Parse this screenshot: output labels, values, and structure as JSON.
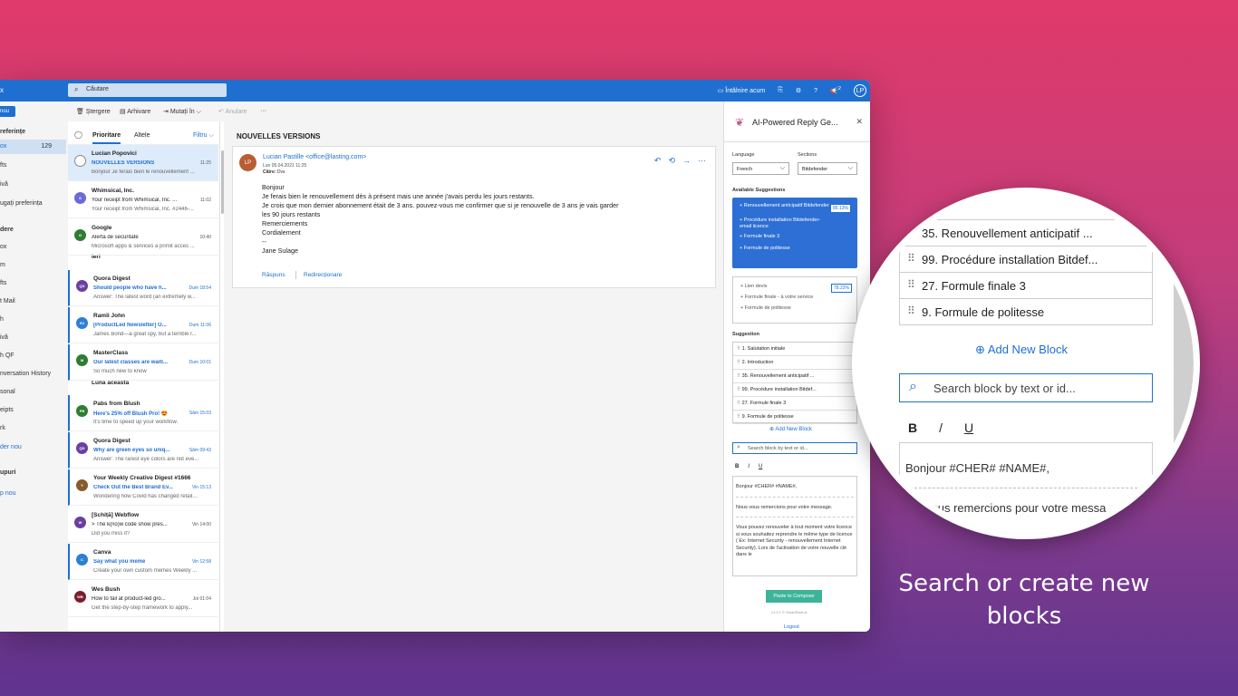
{
  "topbar": {
    "brand": "x",
    "search_placeholder": "Căutare",
    "meet_now": "Întâlnire acum",
    "help": "?",
    "avatar": "LP",
    "notif_count": "2"
  },
  "cmdbar": {
    "new": "nou",
    "delete": "Ștergere",
    "archive": "Arhivare",
    "move": "Mutați în",
    "undo": "Anulare",
    "more": "···"
  },
  "nav": {
    "fav_header": "referințe",
    "items": [
      {
        "label": "ox",
        "count": "129"
      },
      {
        "label": "fts",
        "count": "1"
      },
      {
        "label": "ivă",
        "count": ""
      },
      {
        "label": "ugați preferința",
        "count": ""
      }
    ],
    "folders_header": "dere",
    "folders": [
      {
        "label": "ox",
        "count": "129"
      },
      {
        "label": "m",
        "count": "3"
      },
      {
        "label": "fts",
        "count": "1"
      },
      {
        "label": "t Mail",
        "count": ""
      },
      {
        "label": "h",
        "count": ""
      },
      {
        "label": "ivă",
        "count": ""
      },
      {
        "label": "h QF",
        "count": ""
      },
      {
        "label": "nversation History",
        "count": ""
      },
      {
        "label": "sonal",
        "count": ""
      },
      {
        "label": "eipts",
        "count": ""
      },
      {
        "label": "rk",
        "count": ""
      }
    ],
    "new_folder": "der nou",
    "groups_header": "upuri",
    "new_group": "p nou"
  },
  "list": {
    "tab_focused": "Prioritare",
    "tab_other": "Altele",
    "filter": "Filtru",
    "group_yesterday": "Ieri",
    "group_month": "Luna aceasta",
    "messages": [
      {
        "from": "Lucian Popovici",
        "subject": "NOUVELLES VERSIONS",
        "time": "11:25",
        "preview": "Bonjour Je ferais bien le renouvellement ...",
        "initials": "",
        "color": "#ffffff"
      },
      {
        "from": "Whimsical, Inc.",
        "subject": "Your receipt from Whimsical, Inc. ...",
        "time": "11:02",
        "preview": "Your receipt from Whimsical, Inc. #2446-...",
        "initials": "S",
        "color": "#6a6ad8"
      },
      {
        "from": "Google",
        "subject": "Alertă de securitate",
        "time": "10:40",
        "preview": "Microsoft apps & services a primit acces ...",
        "initials": "G",
        "color": "#2e7d32"
      },
      {
        "from": "Quora Digest",
        "subject": "Should people who have h...",
        "time": "Dum 18:54",
        "preview": "Answer: The latest word (an extremely w...",
        "initials": "QD",
        "color": "#6b3fa0"
      },
      {
        "from": "Ramli John",
        "subject": "[ProductLed Newsletter] O...",
        "time": "Dum 11:06",
        "preview": "James Bond—a great spy, but a terrible r...",
        "initials": "RJ",
        "color": "#2d7fd4"
      },
      {
        "from": "MasterClass",
        "subject": "Our latest classes are waiti...",
        "time": "Dum 10:01",
        "preview": "So much new to know",
        "initials": "M",
        "color": "#2e7d32"
      },
      {
        "from": "Pabs from Blush",
        "subject": "Here's 25% off Blush Pro! 😍",
        "time": "Sâm 15:03",
        "preview": "It's time to speed up your workflow.",
        "initials": "PB",
        "color": "#2e7d32"
      },
      {
        "from": "Quora Digest",
        "subject": "Why are green eyes so uniq...",
        "time": "Sâm 09:43",
        "preview": "Answer: The rarest eye colors are not eve...",
        "initials": "QD",
        "color": "#6b3fa0"
      },
      {
        "from": "Your Weekly Creative Digest #1666",
        "subject": "Check Out the Best Brand Ev...",
        "time": "Vin 15:13",
        "preview": "Wondering how Covid has changed retail...",
        "initials": "Y",
        "color": "#8a5a2a"
      },
      {
        "from": "[Schiță] Webflow",
        "subject": "> The k(no)w code show pres...",
        "time": "Vin 14:00",
        "preview": "Did you miss it?",
        "initials": "W",
        "color": "#6b3fa0"
      },
      {
        "from": "Canva",
        "subject": "Say what you meme",
        "time": "Vin 12:58",
        "preview": "Create your own custom memes Weekly ...",
        "initials": "C",
        "color": "#2d7fd4"
      },
      {
        "from": "Wes Bush",
        "subject": "How to fail at product-led gro...",
        "time": "Joi 01:04",
        "preview": "Get the step-by-step framework to apply...",
        "initials": "WB",
        "color": "#7a1f2a"
      }
    ]
  },
  "reading": {
    "title": "NOUVELLES VERSIONS",
    "avatar": "LP",
    "sender": "Lucian Pastille <office@lasting.com>",
    "date": "Lun 05.04.2021 11:25",
    "to_label": "Către:",
    "to_value": "Dvs",
    "body": [
      "Bonjour",
      "Je ferais bien le renouvellement dès à présent mais une année j'avais perdu les jours restants.",
      "Je crois que mon dernier abonnement était de 3 ans. pouvez-vous me confirmer que si je renouvelle de 3 ans je vais garder",
      "les 90 jours restants",
      "Remerciements",
      "Cordialement",
      "--",
      "Jane Sulage"
    ],
    "reply": "Răspuns",
    "forward": "Redirecționare"
  },
  "pane": {
    "title": "AI-Powered Reply Ge...",
    "language_label": "Language",
    "language_value": "French",
    "sections_label": "Sections",
    "sections_value": "Bitdefender",
    "available_label": "Available Suggestions",
    "available": [
      {
        "text": "Renouvellement anticipatif Bitdefender",
        "pct": "85.13%"
      },
      {
        "text": "Procédure installation Bitdefender-email licence",
        "pct": ""
      },
      {
        "text": "Formule finale 3",
        "pct": ""
      },
      {
        "text": "Formule de politesse",
        "pct": ""
      }
    ],
    "available2": [
      {
        "text": "Lien devis",
        "pct": "78.22%"
      },
      {
        "text": "Formule finale - à votre service",
        "pct": ""
      },
      {
        "text": "Formule de politesse",
        "pct": ""
      }
    ],
    "suggestion_label": "Suggestion",
    "suggestions": [
      "1. Salutation initiale",
      "2. Introduction",
      "35. Renouvellement anticipatif ...",
      "99. Procédure installation Bitdef...",
      "27. Formule finale 3",
      "9. Formule de politesse"
    ],
    "add_block": "Add New Block",
    "search_placeholder": "Search block by text or id...",
    "bold": "B",
    "italic": "I",
    "underline": "U",
    "editor": [
      "Bonjour #CHER# #NAME#,",
      "Nous vous remercions pour votre message.",
      "Vous pouvez renouveler à tout moment votre licence si vous souhaitez reprendre le même type de licence ( Ex: Internet Security - renouvellement Internet Security). Lors de l'activation de votre nouvelle clé dans le"
    ],
    "paste": "Paste to Compose",
    "version": "v1.0.1 © SmartStart.ai",
    "logout": "Logout"
  },
  "zoom": {
    "row0": "ction",
    "rows": [
      "35. Renouvellement anticipatif ...",
      "99. Procédure installation Bitdef...",
      "27. Formule finale 3",
      "9. Formule de politesse"
    ],
    "add_block": "Add New Block",
    "search_placeholder": "Search block by text or id...",
    "bold": "B",
    "italic": "/",
    "underline": "U",
    "line1": "Bonjour #CHER# #NAME#,",
    "line2": "vous remercions pour votre messa"
  },
  "caption": {
    "line1": "Search or create new",
    "line2": "blocks"
  }
}
